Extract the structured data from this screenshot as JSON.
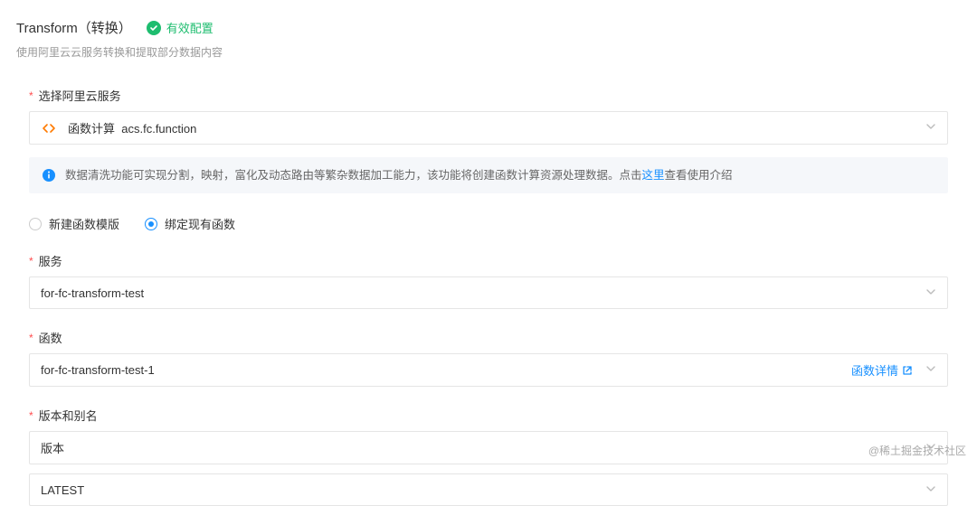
{
  "header": {
    "title": "Transform（转换）",
    "status_text": "有效配置",
    "subtitle": "使用阿里云云服务转换和提取部分数据内容"
  },
  "fields": {
    "service_select": {
      "label": "选择阿里云服务",
      "value_prefix": "函数计算",
      "value_code": "acs.fc.function"
    },
    "info_banner": {
      "text_before": "数据清洗功能可实现分割，映射，富化及动态路由等繁杂数据加工能力，该功能将创建函数计算资源处理数据。点击",
      "link_text": "这里",
      "text_after": "查看使用介绍"
    },
    "radio": {
      "option1": "新建函数模版",
      "option2": "绑定现有函数"
    },
    "service": {
      "label": "服务",
      "value": "for-fc-transform-test"
    },
    "function": {
      "label": "函数",
      "value": "for-fc-transform-test-1",
      "detail_link": "函数详情"
    },
    "version": {
      "label": "版本和别名",
      "select1_value": "版本",
      "select2_value": "LATEST"
    }
  },
  "watermark": "@稀土掘金技术社区"
}
